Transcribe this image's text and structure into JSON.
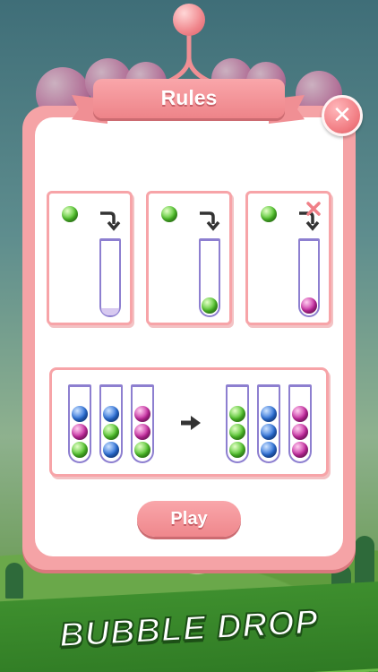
{
  "dialog": {
    "title": "Rules",
    "close_icon": "close-icon",
    "play_label": "Play"
  },
  "rule_cards": [
    {
      "ball": "green",
      "icon": "curved-arrow-icon",
      "tube_content": "empty",
      "allowed": true
    },
    {
      "ball": "green",
      "icon": "curved-arrow-icon",
      "tube_content": "green",
      "allowed": true
    },
    {
      "ball": "green",
      "icon": "curved-arrow-icon",
      "tube_content": "purple",
      "allowed": false,
      "mark": "x-icon"
    }
  ],
  "example": {
    "before": [
      [
        "blue",
        "purple",
        "green"
      ],
      [
        "blue",
        "green",
        "blue"
      ],
      [
        "purple",
        "purple",
        "green"
      ]
    ],
    "after": [
      [
        "green",
        "green",
        "green"
      ],
      [
        "blue",
        "blue",
        "blue"
      ],
      [
        "purple",
        "purple",
        "purple"
      ]
    ],
    "arrow_icon": "right-arrow-icon"
  },
  "banner": {
    "text": "BUBBLE DROP"
  },
  "colors": {
    "accent": "#f5a3a6",
    "green": "#4fc22a",
    "blue": "#2a6fd8",
    "purple": "#c62aa0",
    "tube": "#8d7fd0"
  }
}
